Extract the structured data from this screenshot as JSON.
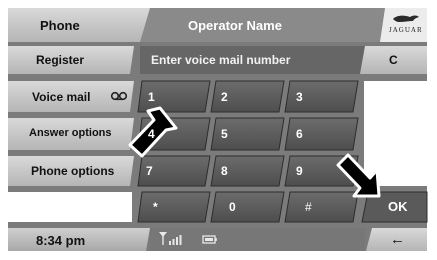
{
  "header": {
    "phone_label": "Phone",
    "operator_name": "Operator Name",
    "brand_name": "JAGUAR"
  },
  "side_menu": {
    "register": "Register",
    "voice_mail": "Voice mail",
    "answer_options": "Answer options",
    "phone_options": "Phone options"
  },
  "entry": {
    "placeholder": "Enter voice mail number",
    "clear_label": "C"
  },
  "keypad": {
    "k1": "1",
    "k2": "2",
    "k3": "3",
    "k4": "4",
    "k5": "5",
    "k6": "6",
    "k7": "7",
    "k8": "8",
    "k9": "9",
    "kstar": "*",
    "k0": "0",
    "khash": "#"
  },
  "actions": {
    "ok_label": "OK",
    "back_symbol": "←"
  },
  "status": {
    "time": "8:34 pm"
  },
  "icons": {
    "voicemail": "voicemail-icon",
    "signal": "signal-strength-icon",
    "battery": "battery-icon",
    "logo": "jaguar-leaper-logo"
  }
}
